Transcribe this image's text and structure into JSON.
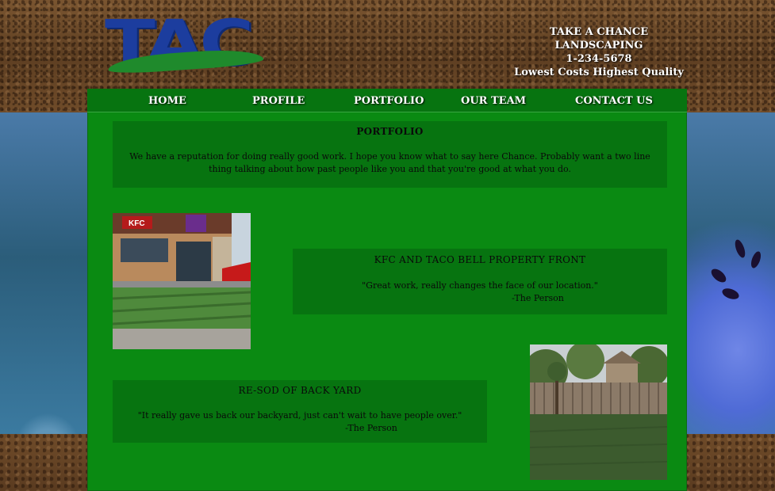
{
  "brand": {
    "logo_text": "TAC",
    "company_lines": [
      "TAKE A CHANCE",
      "LANDSCAPING",
      "1-234-5678"
    ],
    "tagline": "Lowest Costs Highest Quality"
  },
  "nav": {
    "items": [
      {
        "label": "HOME"
      },
      {
        "label": "PROFILE"
      },
      {
        "label": "PORTFOLIO"
      },
      {
        "label": "OUR TEAM"
      },
      {
        "label": "CONTACT US"
      }
    ]
  },
  "intro": {
    "title": "PORTFOLIO",
    "body_line1": "We have a reputation for doing really good work. I hope you know what to say here Chance. Probably want a two line",
    "body_line2": "thing talking about how past people like you and that you're good at what you do."
  },
  "projects": [
    {
      "title": "KFC AND TACO BELL PROPERTY FRONT",
      "quote": "\"Great work, really changes the face of our location.\"",
      "author": "-The Person",
      "image_name": "kfc-taco-bell-storefront-sod-photo"
    },
    {
      "title": "RE-SOD OF BACK YARD",
      "quote": "\"It really gave us back our backyard, just can't wait to have people over.\"",
      "author": "-The Person",
      "image_name": "backyard-sod-fence-photo"
    }
  ],
  "colors": {
    "panel_green": "#0a8a12",
    "box_green": "#077410",
    "logo_blue": "#1c3d9e",
    "logo_green": "#1f8a2c"
  }
}
